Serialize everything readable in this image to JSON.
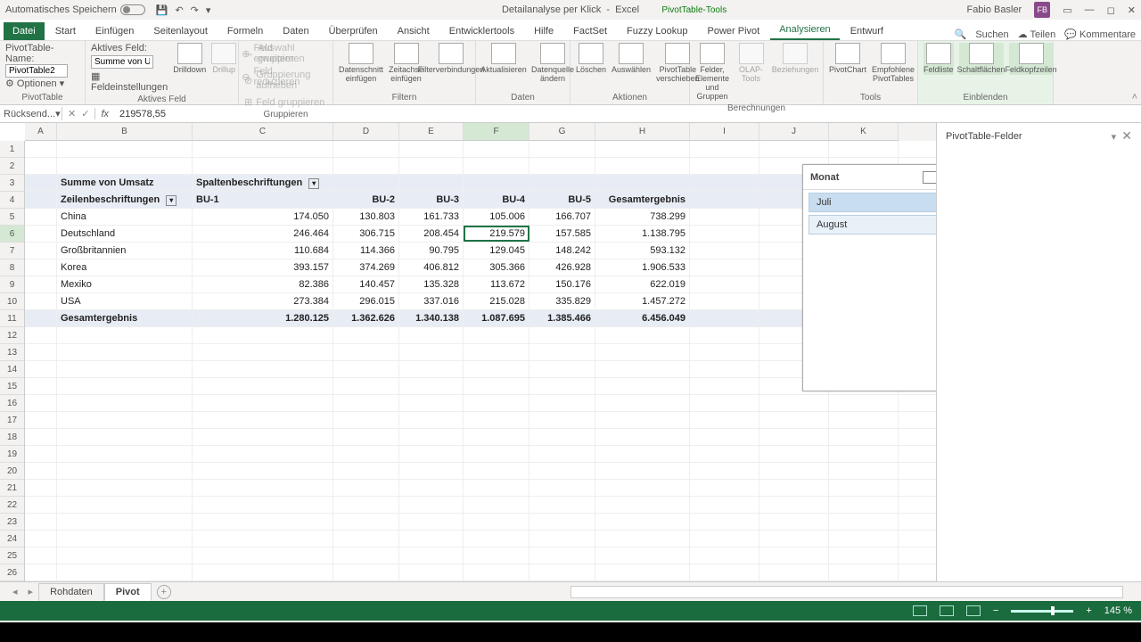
{
  "title": {
    "autosave": "Automatisches Speichern",
    "doc": "Detailanalyse per Klick",
    "app": "Excel",
    "contextual": "PivotTable-Tools",
    "user": "Fabio Basler",
    "initials": "FB"
  },
  "tabs": {
    "file": "Datei",
    "items": [
      "Start",
      "Einfügen",
      "Seitenlayout",
      "Formeln",
      "Daten",
      "Überprüfen",
      "Ansicht",
      "Entwicklertools",
      "Hilfe",
      "FactSet",
      "Fuzzy Lookup",
      "Power Pivot",
      "Analysieren",
      "Entwurf"
    ],
    "active": "Analysieren",
    "search": "Suchen",
    "share": "Teilen",
    "comments": "Kommentare"
  },
  "ribbon": {
    "pivotname": {
      "lbl": "PivotTable-Name:",
      "val": "PivotTable2",
      "opt": "Optionen",
      "group": "PivotTable"
    },
    "activefield": {
      "lbl": "Aktives Feld:",
      "val": "Summe von Ums",
      "fs": "Feldeinstellungen",
      "down": "Drilldown",
      "up": "Drillup",
      "expand": "Feld erweitern",
      "reduce": "Feld reduzieren",
      "group": "Aktives Feld"
    },
    "grouping": {
      "a": "Auswahl gruppieren",
      "b": "Gruppierung aufheben",
      "c": "Feld gruppieren",
      "group": "Gruppieren"
    },
    "filter": {
      "a": "Datenschnitt einfügen",
      "b": "Zeitachse einfügen",
      "c": "Filterverbindungen",
      "group": "Filtern"
    },
    "data": {
      "a": "Aktualisieren",
      "b": "Datenquelle ändern",
      "group": "Daten"
    },
    "actions": {
      "a": "Löschen",
      "b": "Auswählen",
      "c": "PivotTable verschieben",
      "group": "Aktionen"
    },
    "calc": {
      "a": "Felder, Elemente und Gruppen",
      "b": "OLAP-Tools",
      "c": "Beziehungen",
      "group": "Berechnungen"
    },
    "tools": {
      "a": "PivotChart",
      "b": "Empfohlene PivotTables",
      "group": "Tools"
    },
    "show": {
      "a": "Feldliste",
      "b": "Schaltflächen",
      "c": "Feldkopfzeilen",
      "group": "Einblenden"
    }
  },
  "formula": {
    "name": "Rücksend...",
    "value": "219578,55"
  },
  "cols": [
    "A",
    "B",
    "C",
    "D",
    "E",
    "F",
    "G",
    "H",
    "I",
    "J",
    "K"
  ],
  "rows": 26,
  "activeRow": 6,
  "activeColIndex": 5,
  "pivot": {
    "corner": "Summe von Umsatz",
    "colLabel": "Spaltenbeschriftungen",
    "rowLabel": "Zeilenbeschriftungen",
    "buHeaders": [
      "BU-1",
      "BU-2",
      "BU-3",
      "BU-4",
      "BU-5",
      "Gesamtergebnis"
    ],
    "data": [
      {
        "n": "China",
        "v": [
          "174.050",
          "130.803",
          "161.733",
          "105.006",
          "166.707",
          "738.299"
        ]
      },
      {
        "n": "Deutschland",
        "v": [
          "246.464",
          "306.715",
          "208.454",
          "219.579",
          "157.585",
          "1.138.795"
        ]
      },
      {
        "n": "Großbritannien",
        "v": [
          "110.684",
          "114.366",
          "90.795",
          "129.045",
          "148.242",
          "593.132"
        ]
      },
      {
        "n": "Korea",
        "v": [
          "393.157",
          "374.269",
          "406.812",
          "305.366",
          "426.928",
          "1.906.533"
        ]
      },
      {
        "n": "Mexiko",
        "v": [
          "82.386",
          "140.457",
          "135.328",
          "113.672",
          "150.176",
          "622.019"
        ]
      },
      {
        "n": "USA",
        "v": [
          "273.384",
          "296.015",
          "337.016",
          "215.028",
          "335.829",
          "1.457.272"
        ]
      }
    ],
    "totalLabel": "Gesamtergebnis",
    "totals": [
      "1.280.125",
      "1.362.626",
      "1.340.138",
      "1.087.695",
      "1.385.466",
      "6.456.049"
    ]
  },
  "slicer": {
    "title": "Monat",
    "items": [
      "Juli",
      "August"
    ],
    "active": "Juli"
  },
  "fieldpane": {
    "title": "PivotTable-Felder"
  },
  "sheets": {
    "items": [
      "Rohdaten",
      "Pivot"
    ],
    "active": "Pivot"
  },
  "status": {
    "zoom": "145 %"
  }
}
